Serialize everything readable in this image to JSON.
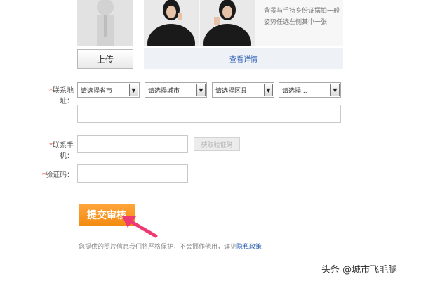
{
  "photo_upload": {
    "upload_label": "上传",
    "sample_text": "背景与手持身份证摆拍一般姿势任选左侧其中一张",
    "detail_link": "查看详情"
  },
  "address": {
    "label": "联系地址：",
    "province": "请选择省市",
    "city": "请选择城市",
    "district": "请选择区县",
    "street": "请选择..."
  },
  "phone": {
    "label": "联系手机：",
    "get_code": "获取验证码"
  },
  "code": {
    "label": "验证码："
  },
  "submit_label": "提交审核",
  "notice": {
    "text": "您提供的照片信息我们将严格保护，不会挪作他用，详见",
    "link": "隐私政策"
  },
  "watermark": "头条 @城市飞毛腿",
  "colors": {
    "submit": "#f5961d",
    "link": "#2a5db0",
    "required": "#e53935",
    "pointer_arrow": "#ee3a72"
  }
}
